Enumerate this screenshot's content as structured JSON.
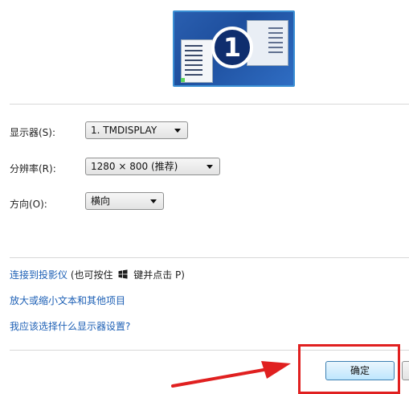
{
  "monitor": {
    "number": "1"
  },
  "settings": {
    "display": {
      "label": "显示器(S):",
      "value": "1. TMDISPLAY"
    },
    "resolution": {
      "label": "分辨率(R):",
      "value": "1280 × 800 (推荐)"
    },
    "orientation": {
      "label": "方向(O):",
      "value": "横向"
    }
  },
  "links": {
    "projector": {
      "text": "连接到投影仪",
      "hint_before": "(也可按住",
      "hint_after": "键并点击 P)"
    },
    "text_size": "放大或缩小文本和其他项目",
    "which_settings": "我应该选择什么显示器设置?"
  },
  "buttons": {
    "ok": "确定"
  },
  "colors": {
    "link": "#1c5fb5",
    "annotation": "#e02020",
    "monitor_bg": "#2a5fb0"
  }
}
